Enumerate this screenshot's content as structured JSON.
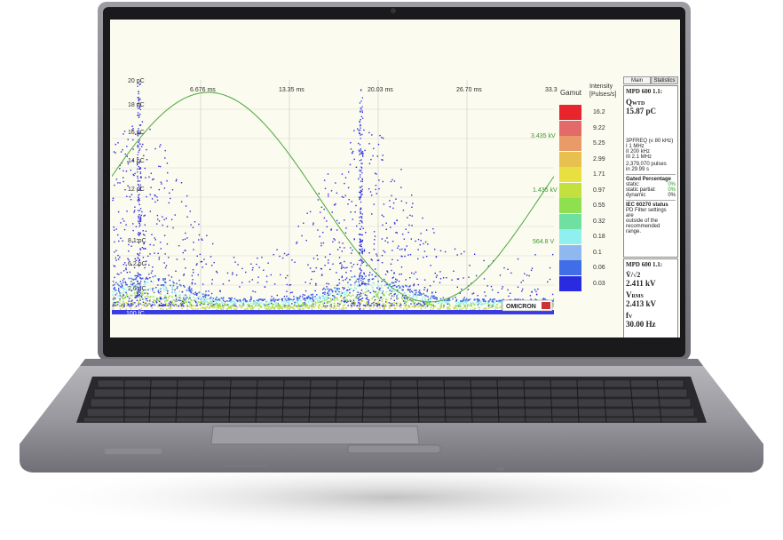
{
  "plot": {
    "y_labels": [
      "20 pC",
      "18 pC",
      "16 pC",
      "14 pC",
      "12 pC",
      "8.1 pC",
      "6.2 pC",
      "2.6 pC",
      "100 fC"
    ],
    "x_labels": [
      "6.676 ms",
      "13.35 ms",
      "20.03 ms",
      "26.70 ms",
      "33.3"
    ],
    "voltage_labels": [
      "3.435 kV",
      "1.435 kV",
      "564.8 V"
    ],
    "brand": "OMICRON"
  },
  "gamut": {
    "title": "Gamut",
    "intensity_title_line1": "Intensity",
    "intensity_title_line2": "[Pulses/s]",
    "values": [
      "16.2",
      "9.22",
      "5.25",
      "2.99",
      "1.71",
      "0.97",
      "0.55",
      "0.32",
      "0.18",
      "0.1",
      "0.06",
      "0.03"
    ],
    "colors": [
      "#e8242c",
      "#e46a6a",
      "#e89a68",
      "#e8c050",
      "#e8e040",
      "#c4e040",
      "#8ee050",
      "#70e0a0",
      "#90f0f0",
      "#90b8f0",
      "#3f6ee8",
      "#2a2ae0"
    ]
  },
  "side_panel": {
    "tab_main": "Main",
    "tab_statistics": "Statistics",
    "device_top": "MPD 600 1.1:",
    "q_symbol": "Q",
    "q_sub": "WTD",
    "q_value": "15.87 pC",
    "freq_line1": "3PFREQ (≤ 80 kHz)",
    "freq_line2": "I    1 MHz",
    "freq_line3": "II   200 kHz",
    "freq_line4": "III  2.1 MHz",
    "pulses_line1": "2,379,070 pulses",
    "pulses_line2": "in 29.99 s",
    "gated_title": "Gated Percentage",
    "gated_static_label": "static:",
    "gated_static_value": "0%",
    "gated_partial_label": "static partial:",
    "gated_partial_value": "0%",
    "gated_dynamic_label": "dynamic",
    "gated_dynamic_value": "0%",
    "iec_title": "IEC 60270 status",
    "iec_text1": "PD Filter settings are",
    "iec_text2": "outside of the",
    "iec_text3": "recommended range.",
    "device_bottom": "MPD 600 1.1:",
    "v_peak_label": "V̂/√2",
    "v_peak_value": "2.411 kV",
    "v_rms_symbol": "V",
    "v_rms_sub": "RMS",
    "v_rms_value": "2.413 kV",
    "f_symbol": "f",
    "f_sub": "V",
    "f_value": "30.00 Hz"
  }
}
